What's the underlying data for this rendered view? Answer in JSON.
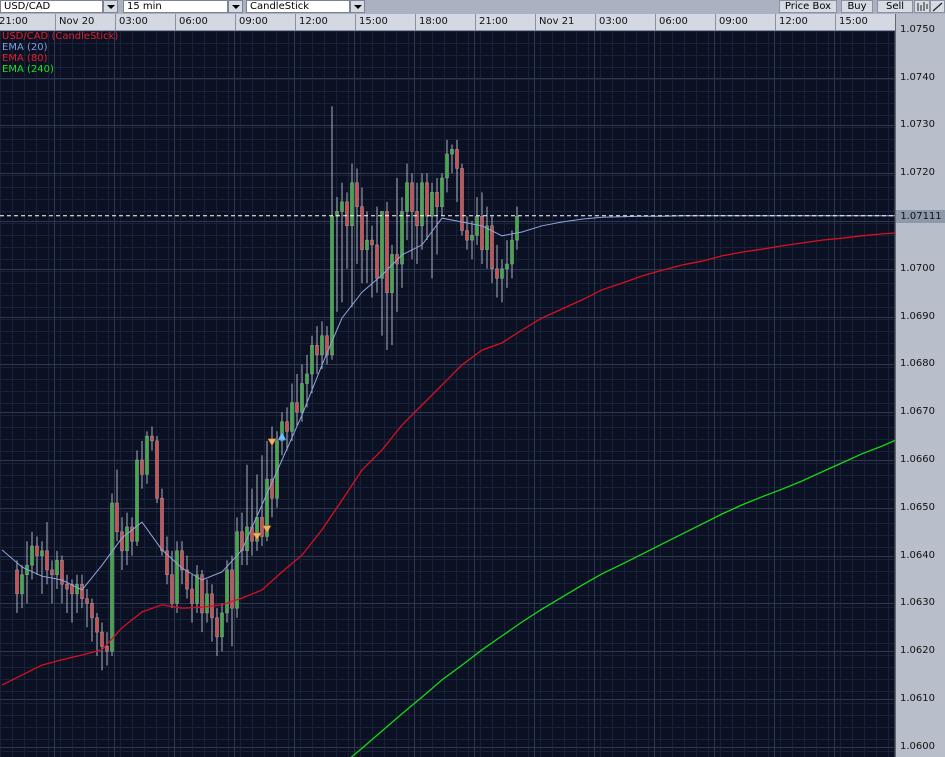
{
  "toolbar": {
    "symbol": "USD/CAD",
    "interval": "15 min",
    "chart_type": "CandleStick",
    "price_box_label": "Price Box",
    "buy_label": "Buy",
    "sell_label": "Sell",
    "icons": [
      "bar-chart-icon",
      "draw-line-icon"
    ]
  },
  "time_axis": [
    "21:00",
    "Nov 20",
    "03:00",
    "06:00",
    "09:00",
    "12:00",
    "15:00",
    "18:00",
    "21:00",
    "Nov 21",
    "03:00",
    "06:00",
    "09:00",
    "12:00",
    "15:00"
  ],
  "price_axis": [
    "1.0750",
    "1.0740",
    "1.0730",
    "1.0720",
    "1.0710",
    "1.0700",
    "1.0690",
    "1.0680",
    "1.0670",
    "1.0660",
    "1.0650",
    "1.0640",
    "1.0630",
    "1.0620",
    "1.0610",
    "1.0600"
  ],
  "current_price": "1.07111",
  "legend": [
    {
      "label": "USD/CAD (CandleStick)",
      "color": "#e0202a"
    },
    {
      "label": "EMA (20)",
      "color": "#7f9fe0"
    },
    {
      "label": "EMA (80)",
      "color": "#e0202a"
    },
    {
      "label": "EMA (240)",
      "color": "#1ee01e"
    }
  ],
  "colors": {
    "up": "#3fae3f",
    "down": "#d05050",
    "background": "#0b1122",
    "ema20": "#8fa6e0",
    "ema80": "#d81020",
    "ema240": "#18d818",
    "current_line": "#ffffff"
  },
  "chart_data": {
    "type": "candlestick",
    "ylim": [
      1.06,
      1.0752
    ],
    "candles_ohlc": [
      [
        1.0637,
        1.0639,
        1.0628,
        1.0632
      ],
      [
        1.0632,
        1.0638,
        1.0629,
        1.0636
      ],
      [
        1.0636,
        1.0643,
        1.063,
        1.0638
      ],
      [
        1.0638,
        1.0645,
        1.0635,
        1.0642
      ],
      [
        1.0642,
        1.0644,
        1.0636,
        1.064
      ],
      [
        1.064,
        1.0643,
        1.0632,
        1.0641
      ],
      [
        1.0641,
        1.0647,
        1.0634,
        1.0637
      ],
      [
        1.0637,
        1.0639,
        1.063,
        1.0636
      ],
      [
        1.0636,
        1.0641,
        1.0633,
        1.0639
      ],
      [
        1.0639,
        1.064,
        1.063,
        1.0634
      ],
      [
        1.0634,
        1.0636,
        1.0628,
        1.0633
      ],
      [
        1.0634,
        1.0635,
        1.0626,
        1.0632
      ],
      [
        1.0632,
        1.0636,
        1.0628,
        1.0634
      ],
      [
        1.0634,
        1.0636,
        1.0629,
        1.0631
      ],
      [
        1.0631,
        1.0633,
        1.0625,
        1.063
      ],
      [
        1.063,
        1.0631,
        1.0622,
        1.0627
      ],
      [
        1.0627,
        1.0628,
        1.0619,
        1.0624
      ],
      [
        1.0624,
        1.0626,
        1.0616,
        1.0621
      ],
      [
        1.0621,
        1.0624,
        1.0617,
        1.062
      ],
      [
        1.062,
        1.0653,
        1.0619,
        1.0651
      ],
      [
        1.0651,
        1.0658,
        1.0643,
        1.0645
      ],
      [
        1.0645,
        1.0648,
        1.0637,
        1.0641
      ],
      [
        1.0641,
        1.0649,
        1.0638,
        1.0646
      ],
      [
        1.0646,
        1.0648,
        1.064,
        1.0643
      ],
      [
        1.0643,
        1.0662,
        1.0642,
        1.066
      ],
      [
        1.066,
        1.0664,
        1.0654,
        1.0657
      ],
      [
        1.0657,
        1.0666,
        1.0655,
        1.0665
      ],
      [
        1.0665,
        1.0667,
        1.0662,
        1.0664
      ],
      [
        1.0664,
        1.0665,
        1.0651,
        1.0652
      ],
      [
        1.0652,
        1.0654,
        1.064,
        1.0641
      ],
      [
        1.0641,
        1.0644,
        1.0634,
        1.0636
      ],
      [
        1.0636,
        1.0641,
        1.0629,
        1.063
      ],
      [
        1.063,
        1.0643,
        1.0628,
        1.0641
      ],
      [
        1.0641,
        1.0643,
        1.0634,
        1.0637
      ],
      [
        1.0637,
        1.064,
        1.0631,
        1.0633
      ],
      [
        1.0633,
        1.0636,
        1.0626,
        1.063
      ],
      [
        1.063,
        1.0638,
        1.0628,
        1.0636
      ],
      [
        1.0636,
        1.0637,
        1.0624,
        1.0628
      ],
      [
        1.0628,
        1.0635,
        1.0626,
        1.0632
      ],
      [
        1.0632,
        1.0634,
        1.0622,
        1.0627
      ],
      [
        1.0627,
        1.0629,
        1.0619,
        1.0623
      ],
      [
        1.0623,
        1.063,
        1.062,
        1.0628
      ],
      [
        1.0628,
        1.0639,
        1.0626,
        1.0637
      ],
      [
        1.0637,
        1.064,
        1.0621,
        1.0629
      ],
      [
        1.0629,
        1.0648,
        1.0627,
        1.0645
      ],
      [
        1.0645,
        1.0649,
        1.0638,
        1.0641
      ],
      [
        1.0641,
        1.0659,
        1.0638,
        1.0646
      ],
      [
        1.0646,
        1.0654,
        1.064,
        1.0643
      ],
      [
        1.0643,
        1.0657,
        1.0641,
        1.0648
      ],
      [
        1.0648,
        1.0661,
        1.0642,
        1.0644
      ],
      [
        1.0644,
        1.0664,
        1.0643,
        1.0656
      ],
      [
        1.0656,
        1.0667,
        1.0648,
        1.0652
      ],
      [
        1.0652,
        1.0666,
        1.065,
        1.0664
      ],
      [
        1.0664,
        1.067,
        1.0661,
        1.0668
      ],
      [
        1.0668,
        1.0671,
        1.0662,
        1.0666
      ],
      [
        1.0666,
        1.0676,
        1.0664,
        1.0672
      ],
      [
        1.0672,
        1.0678,
        1.0667,
        1.067
      ],
      [
        1.067,
        1.068,
        1.0668,
        1.0676
      ],
      [
        1.0676,
        1.0682,
        1.0671,
        1.0678
      ],
      [
        1.0678,
        1.0686,
        1.0674,
        1.0684
      ],
      [
        1.0684,
        1.0688,
        1.0678,
        1.0682
      ],
      [
        1.0682,
        1.0689,
        1.0679,
        1.0686
      ],
      [
        1.0686,
        1.0688,
        1.068,
        1.0682
      ],
      [
        1.0682,
        1.0734,
        1.0681,
        1.0711
      ],
      [
        1.0711,
        1.0715,
        1.0691,
        1.0712
      ],
      [
        1.0712,
        1.0718,
        1.0693,
        1.0714
      ],
      [
        1.0714,
        1.0716,
        1.07,
        1.0709
      ],
      [
        1.0709,
        1.0722,
        1.0692,
        1.0718
      ],
      [
        1.0718,
        1.0721,
        1.0701,
        1.0713
      ],
      [
        1.0713,
        1.0717,
        1.0697,
        1.0704
      ],
      [
        1.0704,
        1.0712,
        1.0697,
        1.0706
      ],
      [
        1.0706,
        1.0709,
        1.0694,
        1.0705
      ],
      [
        1.0705,
        1.0713,
        1.0695,
        1.0698
      ],
      [
        1.0698,
        1.071,
        1.0686,
        1.0712
      ],
      [
        1.0712,
        1.0714,
        1.0683,
        1.0695
      ],
      [
        1.0695,
        1.0705,
        1.0684,
        1.0703
      ],
      [
        1.0703,
        1.0719,
        1.0691,
        1.0701
      ],
      [
        1.0701,
        1.0715,
        1.0696,
        1.0712
      ],
      [
        1.0712,
        1.0722,
        1.0706,
        1.0718
      ],
      [
        1.0718,
        1.072,
        1.0702,
        1.0712
      ],
      [
        1.0712,
        1.0718,
        1.0701,
        1.0709
      ],
      [
        1.0709,
        1.072,
        1.0704,
        1.0718
      ],
      [
        1.0718,
        1.072,
        1.0706,
        1.0711
      ],
      [
        1.0711,
        1.0718,
        1.0698,
        1.0716
      ],
      [
        1.0716,
        1.0719,
        1.0703,
        1.0713
      ],
      [
        1.0713,
        1.072,
        1.0711,
        1.0719
      ],
      [
        1.0719,
        1.0727,
        1.0716,
        1.0724
      ],
      [
        1.0724,
        1.0726,
        1.072,
        1.0725
      ],
      [
        1.0725,
        1.0727,
        1.0714,
        1.0721
      ],
      [
        1.0721,
        1.0722,
        1.0707,
        1.0708
      ],
      [
        1.0708,
        1.0711,
        1.0704,
        1.0706
      ],
      [
        1.0706,
        1.071,
        1.0702,
        1.0707
      ],
      [
        1.0707,
        1.0715,
        1.0705,
        1.0711
      ],
      [
        1.0711,
        1.0716,
        1.0701,
        1.0704
      ],
      [
        1.0704,
        1.0713,
        1.07,
        1.0709
      ],
      [
        1.0709,
        1.0711,
        1.0697,
        1.07
      ],
      [
        1.07,
        1.0705,
        1.0694,
        1.0698
      ],
      [
        1.0698,
        1.0702,
        1.0693,
        1.07
      ],
      [
        1.07,
        1.0706,
        1.0696,
        1.0701
      ],
      [
        1.0701,
        1.0708,
        1.0698,
        1.0706
      ],
      [
        1.0706,
        1.0713,
        1.0704,
        1.0711
      ]
    ],
    "ema_hourly": {
      "ema20": [
        1.06412,
        1.06376,
        1.06357,
        1.06349,
        1.06328,
        1.0638,
        1.06437,
        1.0647,
        1.06412,
        1.06374,
        1.06349,
        1.06366,
        1.06412,
        1.06506,
        1.066,
        1.06694,
        1.06799,
        1.06897,
        1.06951,
        1.06987,
        1.07029,
        1.0705,
        1.07106,
        1.07098,
        1.0709,
        1.07069,
        1.07077,
        1.0709,
        1.07098,
        1.07104,
        1.07108,
        1.07109,
        1.0711,
        1.0711,
        1.07111,
        1.07111,
        1.07111,
        1.07111,
        1.07111,
        1.07111,
        1.07111,
        1.07111,
        1.07111,
        1.07111,
        1.07111
      ],
      "ema80": [
        1.06129,
        1.0615,
        1.06171,
        1.06182,
        1.06192,
        1.06203,
        1.06249,
        1.06282,
        1.06297,
        1.0629,
        1.06292,
        1.06297,
        1.06311,
        1.06328,
        1.06366,
        1.06401,
        1.06454,
        1.06516,
        1.06579,
        1.06621,
        1.06673,
        1.06715,
        1.06757,
        1.06799,
        1.0683,
        1.06845,
        1.06872,
        1.06897,
        1.06916,
        1.06935,
        1.06956,
        1.0697,
        1.06985,
        1.06997,
        1.07008,
        1.07016,
        1.07027,
        1.07035,
        1.07041,
        1.07048,
        1.07054,
        1.0706,
        1.07064,
        1.07069,
        1.07073
      ],
      "ema240": [
        null,
        null,
        null,
        null,
        null,
        null,
        null,
        null,
        null,
        null,
        null,
        null,
        null,
        null,
        null,
        null,
        null,
        1.05962,
        1.05997,
        1.06033,
        1.06069,
        1.06104,
        1.0614,
        1.06171,
        1.06203,
        1.06232,
        1.06261,
        1.06288,
        1.06313,
        1.06338,
        1.06362,
        1.06382,
        1.06403,
        1.06424,
        1.06445,
        1.06466,
        1.06487,
        1.06506,
        1.06523,
        1.06539,
        1.06556,
        1.06575,
        1.06594,
        1.06613,
        1.06629
      ]
    },
    "trade_markers": [
      {
        "type": "sell",
        "candle": 48,
        "price": 1.06439
      },
      {
        "type": "sell",
        "candle": 50,
        "price": 1.06454
      },
      {
        "type": "sell",
        "candle": 51,
        "price": 1.06636
      },
      {
        "type": "buy",
        "candle": 53,
        "price": 1.06648
      }
    ]
  }
}
